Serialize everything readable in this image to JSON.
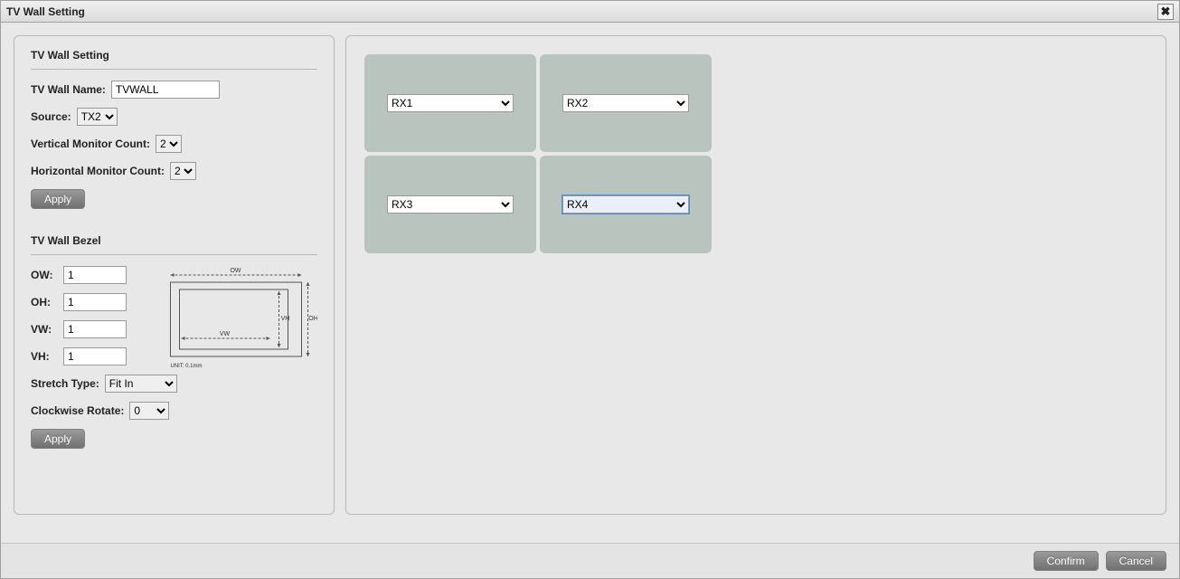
{
  "window": {
    "title": "TV Wall Setting",
    "close_glyph": "✖"
  },
  "settings": {
    "section_title": "TV Wall Setting",
    "name_label": "TV Wall Name:",
    "name_value": "TVWALL",
    "source_label": "Source:",
    "source_value": "TX2",
    "vcount_label": "Vertical Monitor Count:",
    "vcount_value": "2",
    "hcount_label": "Horizontal Monitor Count:",
    "hcount_value": "2",
    "apply_label": "Apply"
  },
  "bezel": {
    "section_title": "TV Wall Bezel",
    "ow_label": "OW:",
    "ow_value": "1",
    "oh_label": "OH:",
    "oh_value": "1",
    "vw_label": "VW:",
    "vw_value": "1",
    "vh_label": "VH:",
    "vh_value": "1",
    "diagram": {
      "ow": "OW",
      "oh": "OH",
      "vw": "VW",
      "vh": "VH",
      "unit": "UNIT: 0.1mm"
    },
    "stretch_label": "Stretch Type:",
    "stretch_value": "Fit In",
    "rotate_label": "Clockwise Rotate:",
    "rotate_value": "0",
    "apply_label": "Apply"
  },
  "monitors": {
    "cells": [
      "RX1",
      "RX2",
      "RX3",
      "RX4"
    ],
    "active_index": 3
  },
  "footer": {
    "confirm_label": "Confirm",
    "cancel_label": "Cancel"
  }
}
